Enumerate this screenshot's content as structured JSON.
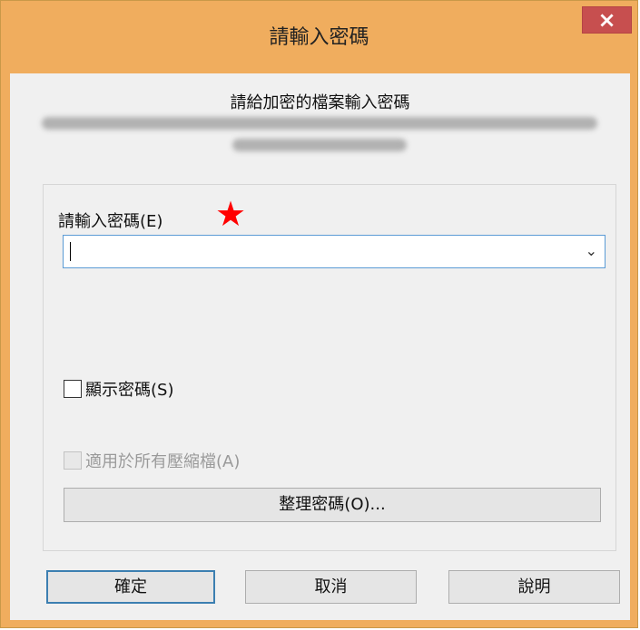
{
  "window": {
    "title": "請輸入密碼",
    "close_symbol": "×"
  },
  "prompt": {
    "message": "請給加密的檔案輸入密碼"
  },
  "password": {
    "label": "請輸入密碼(E)",
    "annotation_star": "★",
    "value": "",
    "dropdown_symbol": "⌄"
  },
  "options": {
    "show_password_label": "顯示密碼(S)",
    "show_password_checked": false,
    "apply_all_label": "適用於所有壓縮檔(A)",
    "apply_all_checked": false,
    "apply_all_enabled": false
  },
  "buttons": {
    "manage_label": "整理密碼(O)...",
    "ok_label": "確定",
    "cancel_label": "取消",
    "help_label": "說明"
  },
  "colors": {
    "titlebar": "#f0ad5e",
    "close_button": "#c74f4f",
    "focus_border": "#3c7fb1",
    "star": "#ff0000"
  }
}
